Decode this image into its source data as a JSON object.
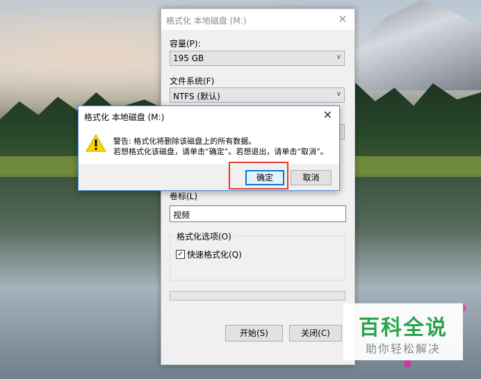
{
  "format_window": {
    "title": "格式化 本地磁盘 (M:)",
    "close_glyph": "✕",
    "capacity_label": "容量(P):",
    "capacity_value": "195 GB",
    "filesystem_label": "文件系统(F)",
    "filesystem_value": "NTFS (默认)",
    "volume_label_caption": "卷标(L)",
    "volume_label_value": "视频",
    "format_options_label": "格式化选项(O)",
    "quick_format_label": "快速格式化(Q)",
    "quick_format_checked": true,
    "progress": 0,
    "start_button": "开始(S)",
    "close_button": "关闭(C)"
  },
  "alert_dialog": {
    "title": "格式化 本地磁盘 (M:)",
    "close_glyph": "✕",
    "icon": "warning-icon",
    "message_line1": "警告: 格式化将删除该磁盘上的所有数据。",
    "message_line2": "若想格式化该磁盘，请单击“确定”。若想退出，请单击“取消”。",
    "ok_button": "确定",
    "cancel_button": "取消"
  },
  "watermark": {
    "title": "百科全说",
    "subtitle": "助你轻松解决"
  },
  "colors": {
    "accent": "#0078d7",
    "highlight": "#e43a32",
    "watermark_green": "#2aa44a"
  }
}
